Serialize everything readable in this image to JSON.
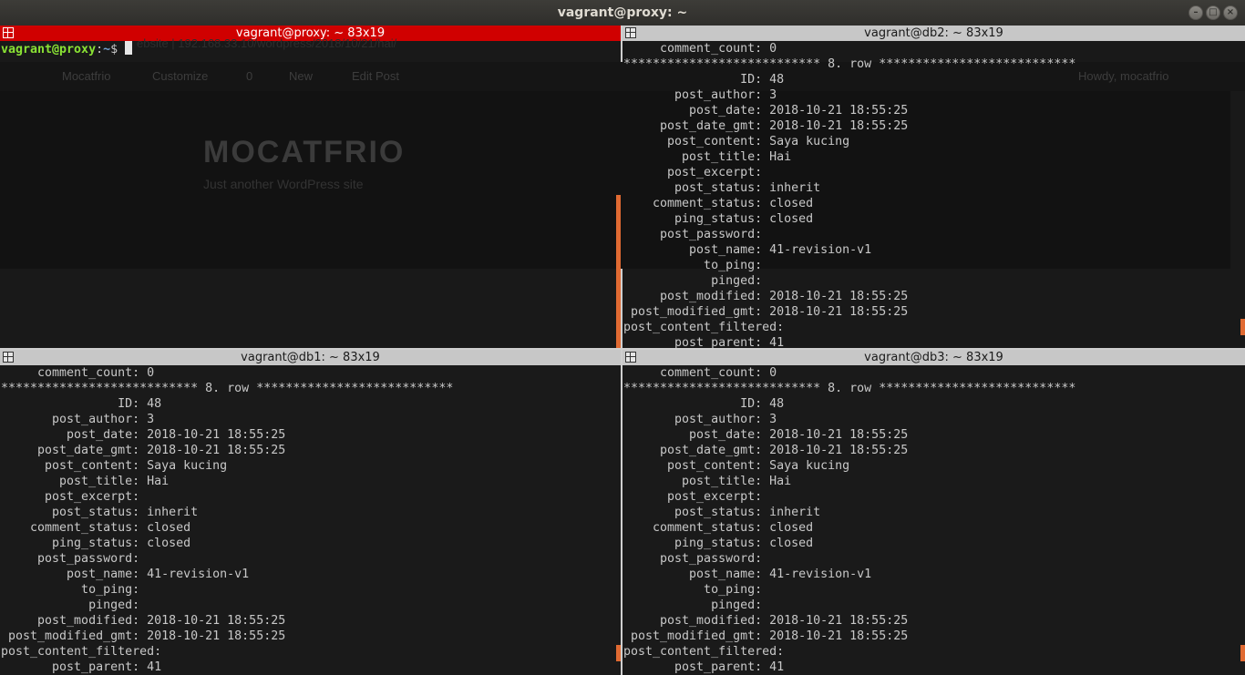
{
  "window": {
    "title": "vagrant@proxy: ~",
    "buttons": [
      "–",
      "□",
      "×"
    ]
  },
  "background_browser": {
    "url": "ebsite  |  192.168.33.10/wordpress/2018/10/21/hai/",
    "admin_bar": [
      "Mocatfrio",
      "Customize",
      "0",
      "New",
      "Edit Post",
      "Howdy, mocatfrio"
    ],
    "site_title": "MOCATFRIO",
    "tagline": "Just another WordPress site"
  },
  "panes": {
    "proxy": {
      "title": "vagrant@proxy: ~ 83x19",
      "prompt_user": "vagrant@proxy",
      "prompt_sep": ":",
      "prompt_path": "~",
      "prompt_symbol": "$ "
    },
    "db2": {
      "title": "vagrant@db2: ~ 83x19",
      "lines": [
        "     comment_count: 0",
        "*************************** 8. row ***************************",
        "                ID: 48",
        "       post_author: 3",
        "         post_date: 2018-10-21 18:55:25",
        "     post_date_gmt: 2018-10-21 18:55:25",
        "      post_content: Saya kucing",
        "        post_title: Hai",
        "      post_excerpt: ",
        "       post_status: inherit",
        "    comment_status: closed",
        "       ping_status: closed",
        "     post_password: ",
        "         post_name: 41-revision-v1",
        "           to_ping: ",
        "            pinged: ",
        "     post_modified: 2018-10-21 18:55:25",
        " post_modified_gmt: 2018-10-21 18:55:25",
        "post_content_filtered: ",
        "       post_parent: 41"
      ]
    },
    "db1": {
      "title": "vagrant@db1: ~ 83x19",
      "lines": [
        "     comment_count: 0",
        "*************************** 8. row ***************************",
        "                ID: 48",
        "       post_author: 3",
        "         post_date: 2018-10-21 18:55:25",
        "     post_date_gmt: 2018-10-21 18:55:25",
        "      post_content: Saya kucing",
        "        post_title: Hai",
        "      post_excerpt: ",
        "       post_status: inherit",
        "    comment_status: closed",
        "       ping_status: closed",
        "     post_password: ",
        "         post_name: 41-revision-v1",
        "           to_ping: ",
        "            pinged: ",
        "     post_modified: 2018-10-21 18:55:25",
        " post_modified_gmt: 2018-10-21 18:55:25",
        "post_content_filtered: ",
        "       post_parent: 41"
      ]
    },
    "db3": {
      "title": "vagrant@db3: ~ 83x19",
      "lines": [
        "     comment_count: 0",
        "*************************** 8. row ***************************",
        "                ID: 48",
        "       post_author: 3",
        "         post_date: 2018-10-21 18:55:25",
        "     post_date_gmt: 2018-10-21 18:55:25",
        "      post_content: Saya kucing",
        "        post_title: Hai",
        "      post_excerpt: ",
        "       post_status: inherit",
        "    comment_status: closed",
        "       ping_status: closed",
        "     post_password: ",
        "         post_name: 41-revision-v1",
        "           to_ping: ",
        "            pinged: ",
        "     post_modified: 2018-10-21 18:55:25",
        " post_modified_gmt: 2018-10-21 18:55:25",
        "post_content_filtered: ",
        "       post_parent: 41"
      ]
    }
  },
  "colors": {
    "active_title": "#d00000",
    "inactive_title": "#c7c7c7",
    "scrollbar": "#e06a32",
    "prompt_user": "#8ae234",
    "prompt_path": "#729fcf"
  }
}
